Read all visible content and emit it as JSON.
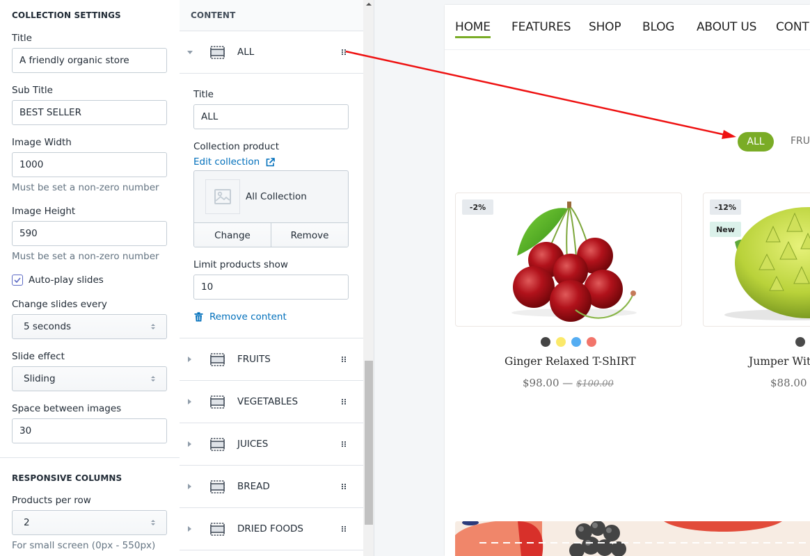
{
  "settings": {
    "section_title": "COLLECTION SETTINGS",
    "title_label": "Title",
    "title_value": "A friendly organic store",
    "subtitle_label": "Sub Title",
    "subtitle_value": "BEST SELLER",
    "image_width_label": "Image Width",
    "image_width_value": "1000",
    "image_width_help": "Must be set a non-zero number",
    "image_height_label": "Image Height",
    "image_height_value": "590",
    "image_height_help": "Must be set a non-zero number",
    "autoplay_label": "Auto-play slides",
    "autoplay_checked": true,
    "change_every_label": "Change slides every",
    "change_every_value": "5 seconds",
    "slide_effect_label": "Slide effect",
    "slide_effect_value": "Sliding",
    "space_label": "Space between images",
    "space_value": "30",
    "responsive_title": "RESPONSIVE COLUMNS",
    "per_row_label": "Products per row",
    "per_row_value": "2",
    "per_row_help": "For small screen (0px - 550px)"
  },
  "content": {
    "header": "CONTENT",
    "expanded_block": {
      "label": "ALL",
      "title_label": "Title",
      "title_value": "ALL",
      "collection_label": "Collection product",
      "edit_link": "Edit collection",
      "collection_name": "All Collection",
      "change_label": "Change",
      "remove_label": "Remove",
      "limit_label": "Limit products show",
      "limit_value": "10",
      "remove_content_label": "Remove content"
    },
    "blocks": [
      {
        "label": "FRUITS"
      },
      {
        "label": "VEGETABLES"
      },
      {
        "label": "JUICES"
      },
      {
        "label": "BREAD"
      },
      {
        "label": "DRIED FOODS"
      }
    ]
  },
  "preview": {
    "nav": [
      "HOME",
      "FEATURES",
      "SHOP",
      "BLOG",
      "ABOUT US",
      "CONT"
    ],
    "active_nav": "HOME",
    "tabs": {
      "active": "ALL",
      "next": "FRU"
    },
    "accent_color": "#7aac26",
    "products": [
      {
        "name": "Ginger Relaxed T-ShIRT",
        "price": "$98.00",
        "separator": "—",
        "old_price": "$100.00",
        "badges": [
          "-2%"
        ],
        "swatches": [
          "#444444",
          "#fbe96a",
          "#55adf2",
          "#f2756b"
        ],
        "image": "cherries"
      },
      {
        "name": "Jumper Wit",
        "price": "$88.00",
        "badges": [
          "-12%",
          "New"
        ],
        "swatches": [
          "#4a4a4a"
        ],
        "image": "romanesco"
      }
    ]
  },
  "annotation": {
    "type": "arrow",
    "color": "#ee1111",
    "from": "content-block-all drag handle",
    "to": "preview tab ALL"
  }
}
